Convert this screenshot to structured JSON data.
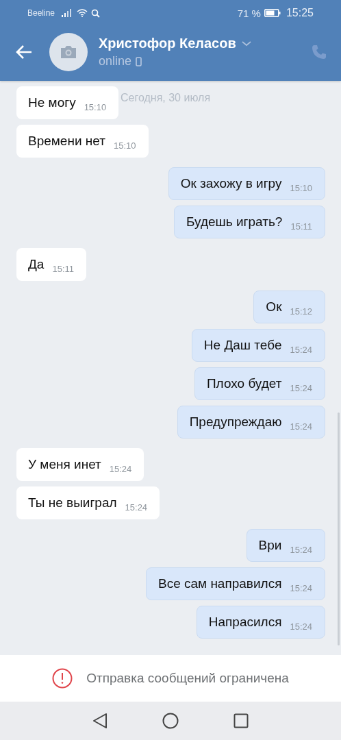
{
  "status_bar": {
    "carrier": "Beeline",
    "battery": "71 %",
    "time": "15:25"
  },
  "header": {
    "name": "Христофор Келасов",
    "status": "online"
  },
  "date_label": "Сегодня, 30 июля",
  "messages": [
    {
      "kind": "incoming",
      "text": "Не могу",
      "time": "15:10"
    },
    {
      "kind": "incoming",
      "text": "Времени нет",
      "time": "15:10"
    },
    {
      "kind": "outgoing",
      "text": "Ок захожу в игру",
      "time": "15:10"
    },
    {
      "kind": "outgoing",
      "text": "Будешь играть?",
      "time": "15:11"
    },
    {
      "kind": "incoming",
      "text": "Да",
      "time": "15:11"
    },
    {
      "kind": "outgoing",
      "text": "Ок",
      "time": "15:12"
    },
    {
      "kind": "outgoing",
      "text": "Не Даш тебе",
      "time": "15:24"
    },
    {
      "kind": "outgoing",
      "text": "Плохо будет",
      "time": "15:24"
    },
    {
      "kind": "outgoing",
      "text": "Предупреждаю",
      "time": "15:24"
    },
    {
      "kind": "incoming",
      "text": "У меня инет",
      "time": "15:24"
    },
    {
      "kind": "incoming",
      "text": "Ты не выиграл",
      "time": "15:24"
    },
    {
      "kind": "outgoing",
      "text": "Ври",
      "time": "15:24"
    },
    {
      "kind": "outgoing",
      "text": "Все сам направился",
      "time": "15:24"
    },
    {
      "kind": "outgoing",
      "text": "Напрасился",
      "time": "15:24"
    }
  ],
  "notice": "Отправка сообщений ограничена"
}
